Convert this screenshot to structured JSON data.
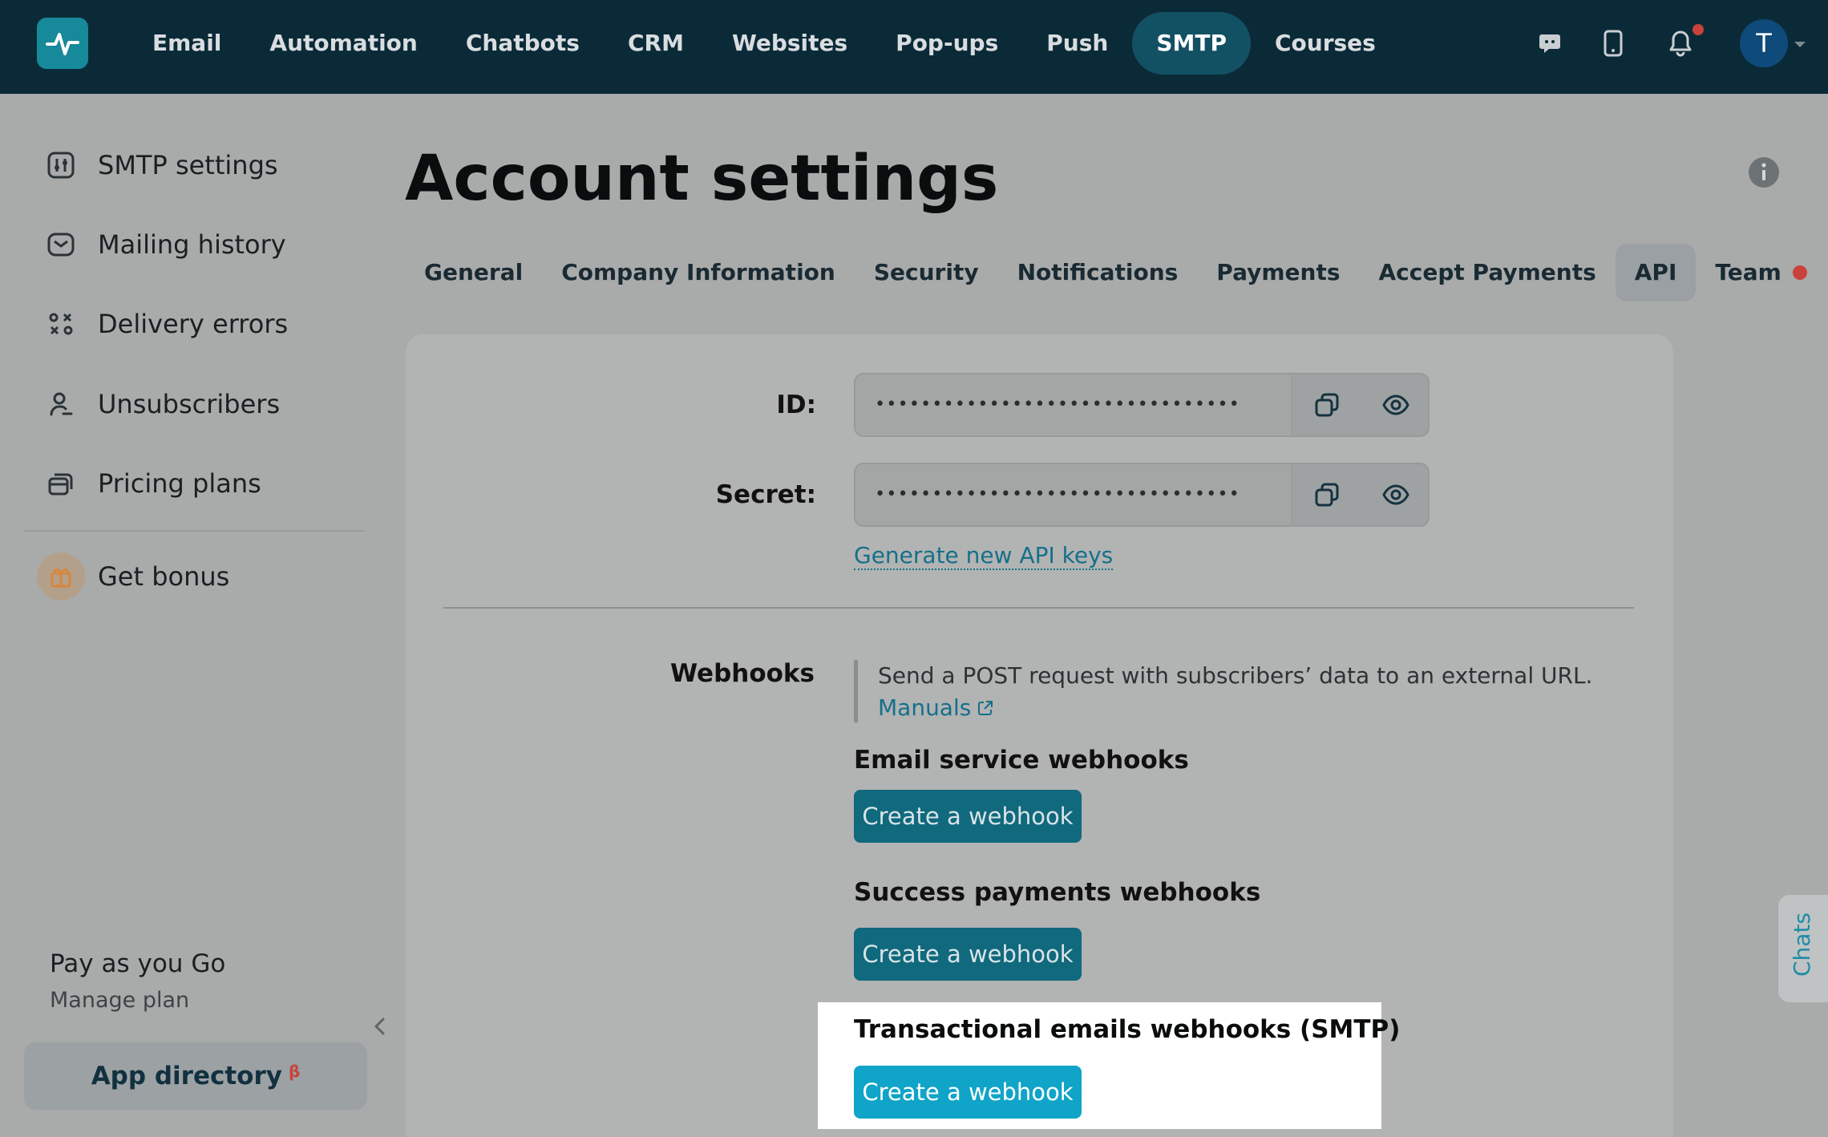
{
  "topnav": {
    "items": [
      "Email",
      "Automation",
      "Chatbots",
      "CRM",
      "Websites",
      "Pop-ups",
      "Push",
      "SMTP",
      "Courses"
    ],
    "active": "SMTP",
    "avatar_initial": "T",
    "icons": [
      "chat-icon",
      "mobile-icon",
      "bell-icon"
    ]
  },
  "sidebar": {
    "items": [
      {
        "label": "SMTP settings",
        "icon": "settings-sliders-icon"
      },
      {
        "label": "Mailing history",
        "icon": "mailing-history-icon"
      },
      {
        "label": "Delivery errors",
        "icon": "delivery-errors-icon"
      },
      {
        "label": "Unsubscribers",
        "icon": "user-icon"
      },
      {
        "label": "Pricing plans",
        "icon": "pricing-cards-icon"
      }
    ],
    "bonus": {
      "label": "Get bonus",
      "icon": "gift-icon"
    },
    "plan": {
      "name": "Pay as you Go",
      "manage": "Manage plan"
    },
    "app_directory": {
      "label": "App directory",
      "badge": "β"
    }
  },
  "main": {
    "title": "Account settings",
    "tabs": [
      "General",
      "Company Information",
      "Security",
      "Notifications",
      "Payments",
      "Accept Payments",
      "API",
      "Team"
    ],
    "active_tab": "API",
    "api": {
      "id_label": "ID:",
      "id_value": "••••••••••••••••••••••••••••••••",
      "secret_label": "Secret:",
      "secret_value": "••••••••••••••••••••••••••••••••",
      "generate_link": "Generate new API keys"
    },
    "webhooks": {
      "label": "Webhooks",
      "description": "Send a POST request with subscribers’ data to an external URL.",
      "manuals": "Manuals",
      "groups": [
        {
          "title": "Email service webhooks",
          "button": "Create a webhook"
        },
        {
          "title": "Success payments webhooks",
          "button": "Create a webhook"
        },
        {
          "title": "Transactional emails webhooks (SMTP)",
          "button": "Create a webhook"
        }
      ]
    }
  },
  "chats_tab": "Chats",
  "colors": {
    "topbar": "#0b2a38",
    "accent": "#16899a",
    "button": "#10697d",
    "highlight_button": "#0fa4c8",
    "link": "#14708a",
    "alert": "#c9423b"
  }
}
